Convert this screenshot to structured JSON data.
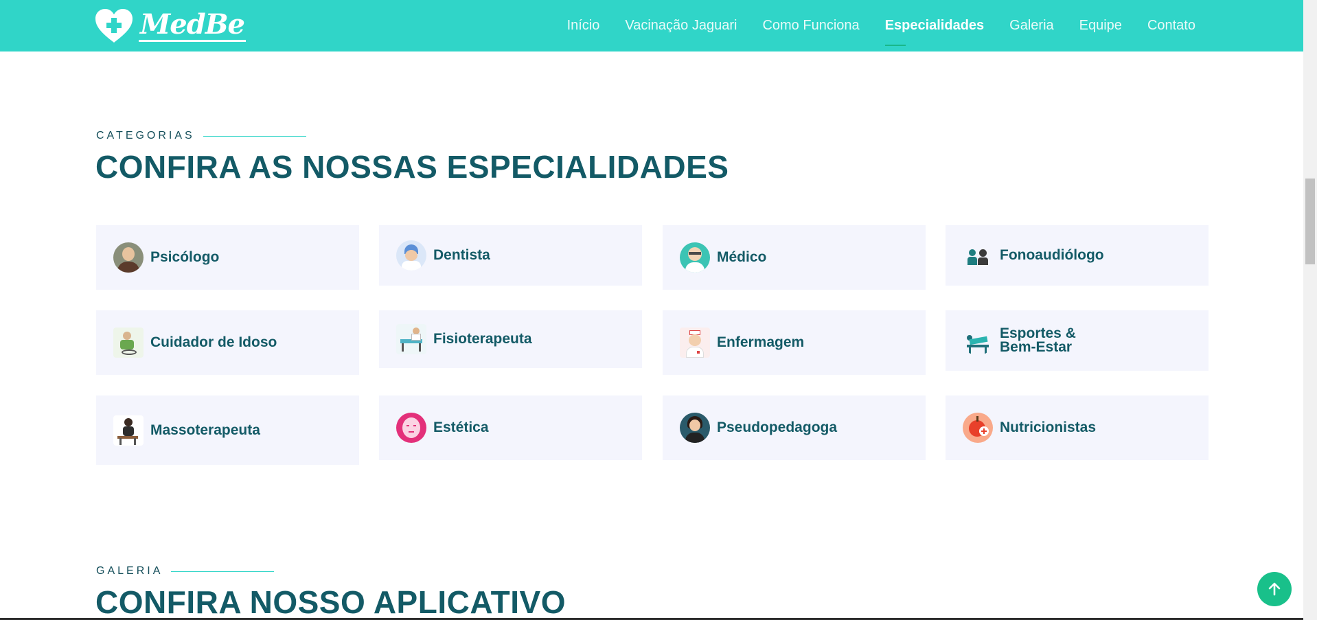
{
  "brand": {
    "name": "MedBe"
  },
  "nav": {
    "items": [
      {
        "label": "Início",
        "active": false
      },
      {
        "label": "Vacinação Jaguari",
        "active": false
      },
      {
        "label": "Como Funciona",
        "active": false
      },
      {
        "label": "Especialidades",
        "active": true
      },
      {
        "label": "Galeria",
        "active": false
      },
      {
        "label": "Equipe",
        "active": false
      },
      {
        "label": "Contato",
        "active": false
      }
    ]
  },
  "categories_section": {
    "kicker": "CATEGORIAS",
    "title": "CONFIRA AS NOSSAS ESPECIALIDADES",
    "cards": [
      {
        "label": "Psicólogo",
        "icon": "psychologist-icon"
      },
      {
        "label": "Dentista",
        "icon": "dentist-icon"
      },
      {
        "label": "Médico",
        "icon": "doctor-icon"
      },
      {
        "label": "Fonoaudiólogo",
        "icon": "speech-therapist-icon"
      },
      {
        "label": "Cuidador de Idoso",
        "icon": "elderly-caregiver-icon"
      },
      {
        "label": "Fisioterapeuta",
        "icon": "physiotherapist-icon"
      },
      {
        "label": "Enfermagem",
        "icon": "nurse-icon"
      },
      {
        "label": "Esportes & Bem-Estar",
        "icon": "sports-wellness-icon"
      },
      {
        "label": "Massoterapeuta",
        "icon": "massage-therapist-icon"
      },
      {
        "label": "Estética",
        "icon": "aesthetics-icon"
      },
      {
        "label": "Pseudopedagoga",
        "icon": "pedagogue-icon"
      },
      {
        "label": "Nutricionistas",
        "icon": "nutritionist-icon"
      }
    ]
  },
  "gallery_section": {
    "kicker": "GALERIA",
    "title": "CONFIRA NOSSO APLICATIVO"
  },
  "colors": {
    "header_bg": "#30d5c8",
    "heading": "#135a66",
    "card_bg": "#f4f5fd",
    "accent_green": "#19c08a"
  },
  "back_to_top": {
    "icon": "arrow-up-icon"
  }
}
